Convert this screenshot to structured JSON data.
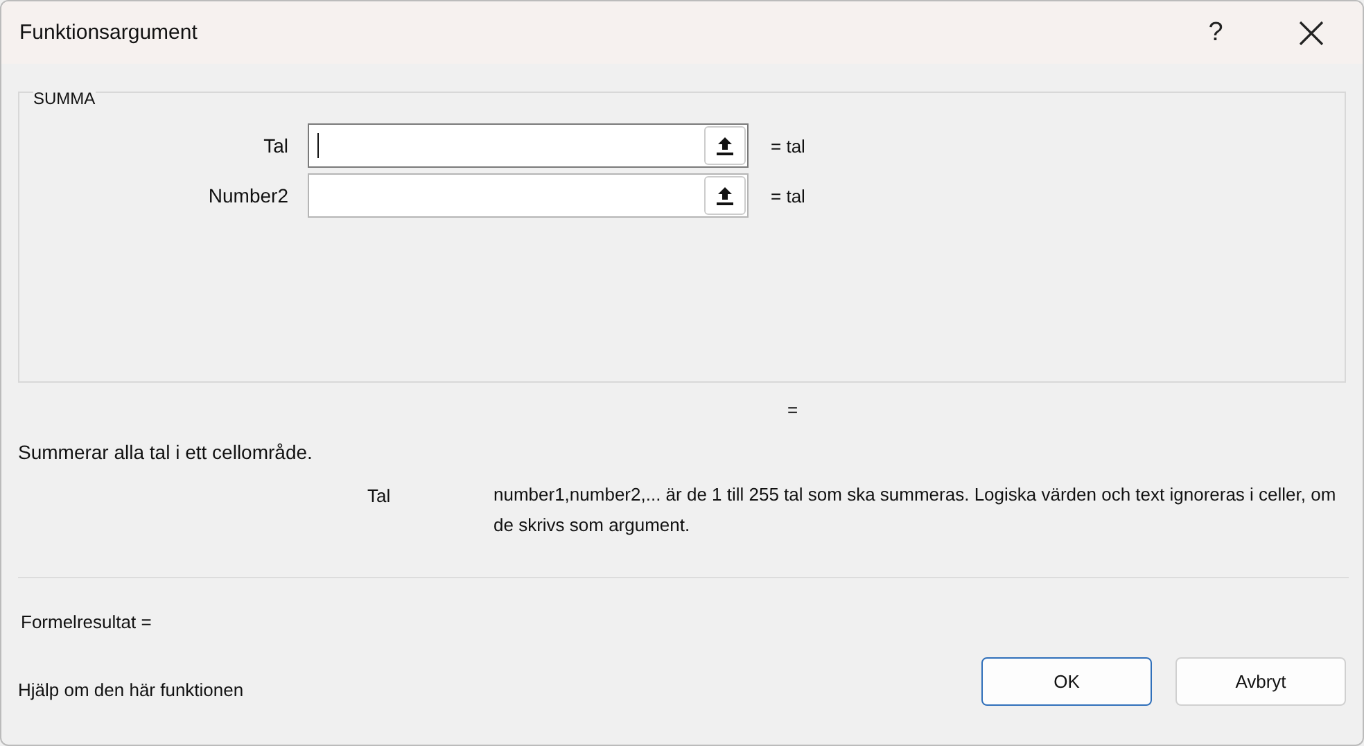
{
  "window": {
    "title": "Funktionsargument",
    "help_button": "?"
  },
  "function_group": {
    "title": "SUMMA",
    "arguments": [
      {
        "label": "Tal",
        "result": "= tal",
        "focused": true
      },
      {
        "label": "Number2",
        "result": "= tal",
        "focused": false
      }
    ]
  },
  "function_result": "=",
  "description": "Summerar alla tal i ett cellområde.",
  "argument_help": {
    "name": "Tal",
    "text": "number1,number2,... är de 1 till 255 tal som ska summeras. Logiska värden och text ignoreras i celler, om de skrivs som argument."
  },
  "formula_result": "Formelresultat =",
  "help_link": "Hjälp om den här funktionen",
  "buttons": [
    {
      "label": "OK",
      "selected": true
    },
    {
      "label": "Avbryt",
      "selected": false
    }
  ]
}
